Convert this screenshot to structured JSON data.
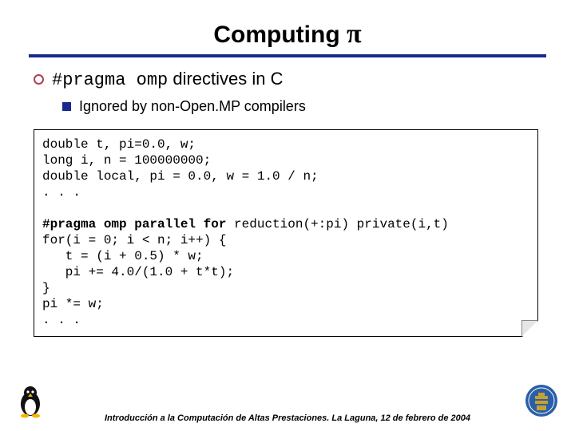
{
  "title": {
    "text": "Computing ",
    "symbol": "π"
  },
  "bullet1": {
    "code": "#pragma omp",
    "rest": " directives in C"
  },
  "bullet2": {
    "text": "Ignored by non-Open.MP compilers"
  },
  "code": {
    "l1": "double t, pi=0.0, w;",
    "l2": "long i, n = 100000000;",
    "l3": "double local, pi = 0.0, w = 1.0 / n;",
    "l4": ". . .",
    "l5a": "#pragma omp parallel for",
    "l5b": " reduction(+:pi) private(i,t)",
    "l6": "for(i = 0; i < n; i++) {",
    "l7": "   t = (i + 0.5) * w;",
    "l8": "   pi += 4.0/(1.0 + t*t);",
    "l9": "}",
    "l10": "pi *= w;",
    "l11": ". . ."
  },
  "footer": "Introducción a la Computación de Altas Prestaciones. La Laguna, 12 de febrero de 2004",
  "icons": {
    "left": "penguin-logo",
    "right": "university-crest"
  }
}
